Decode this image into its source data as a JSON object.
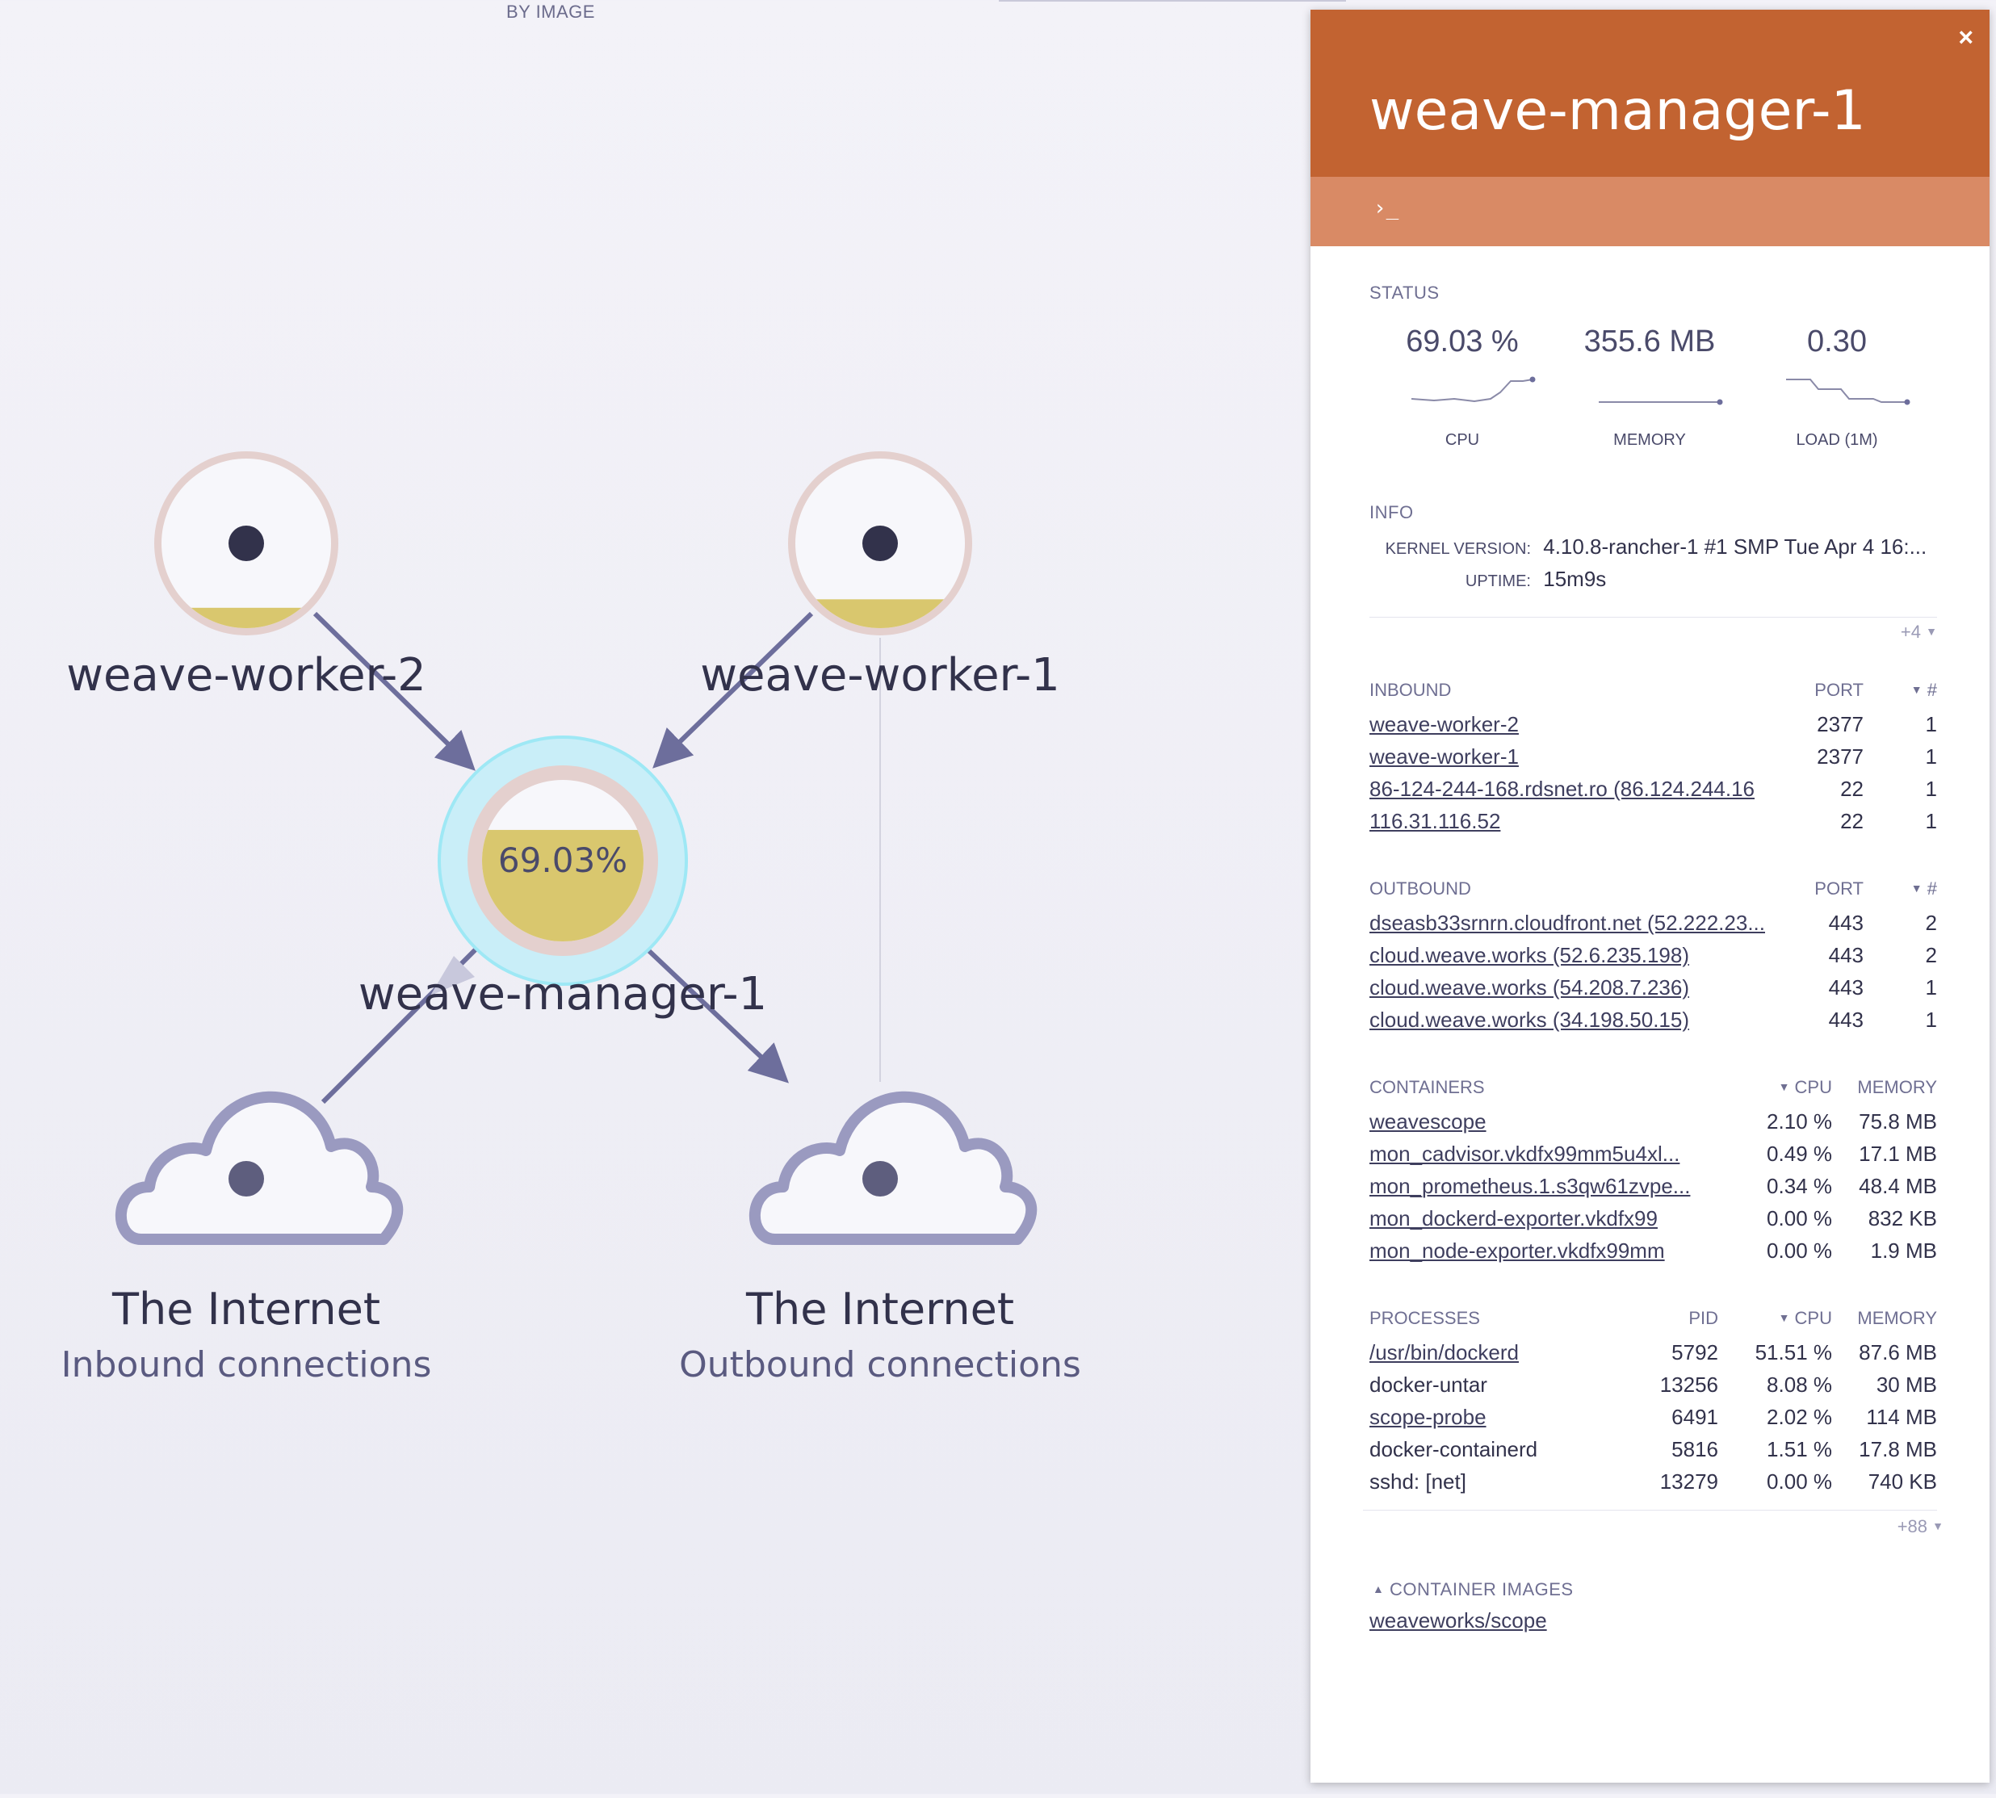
{
  "topology": {
    "view_label": "BY IMAGE",
    "nodes": {
      "worker2": {
        "label": "weave-worker-2",
        "metric_fraction": 0.12
      },
      "worker1": {
        "label": "weave-worker-1",
        "metric_fraction": 0.17
      },
      "manager": {
        "label": "weave-manager-1",
        "metric_text": "69.03%",
        "metric_fraction": 0.6903
      },
      "internet_in": {
        "label": "The Internet",
        "sublabel": "Inbound connections"
      },
      "internet_out": {
        "label": "The Internet",
        "sublabel": "Outbound connections"
      }
    },
    "colors": {
      "accent": "#c26331",
      "edge": "#6d6e9c",
      "metric_fill": "#d9c76e",
      "focus": "#9ee8f5"
    }
  },
  "details": {
    "title": "weave-manager-1",
    "close_icon": "×",
    "terminal_icon": "›_",
    "status": {
      "title": "STATUS",
      "metrics": [
        {
          "value": "69.03 %",
          "label": "CPU"
        },
        {
          "value": "355.6 MB",
          "label": "MEMORY"
        },
        {
          "value": "0.30",
          "label": "LOAD (1M)"
        }
      ]
    },
    "info": {
      "title": "INFO",
      "rows": [
        {
          "key": "KERNEL VERSION:",
          "value": "4.10.8-rancher-1 #1 SMP Tue Apr 4 16:..."
        },
        {
          "key": "UPTIME:",
          "value": "15m9s"
        }
      ],
      "more": "+4"
    },
    "inbound": {
      "title": "INBOUND",
      "col_port": "PORT",
      "col_count": "#",
      "rows": [
        {
          "name": "weave-worker-2",
          "port": "2377",
          "count": "1"
        },
        {
          "name": "weave-worker-1",
          "port": "2377",
          "count": "1"
        },
        {
          "name": "86-124-244-168.rdsnet.ro (86.124.244.16",
          "port": "22",
          "count": "1"
        },
        {
          "name": "116.31.116.52",
          "port": "22",
          "count": "1"
        }
      ]
    },
    "outbound": {
      "title": "OUTBOUND",
      "col_port": "PORT",
      "col_count": "#",
      "rows": [
        {
          "name": "dseasb33srnrn.cloudfront.net (52.222.23...",
          "port": "443",
          "count": "2"
        },
        {
          "name": "cloud.weave.works (52.6.235.198)",
          "port": "443",
          "count": "2"
        },
        {
          "name": "cloud.weave.works (54.208.7.236)",
          "port": "443",
          "count": "1"
        },
        {
          "name": "cloud.weave.works (34.198.50.15)",
          "port": "443",
          "count": "1"
        }
      ]
    },
    "containers": {
      "title": "CONTAINERS",
      "col_cpu": "CPU",
      "col_mem": "MEMORY",
      "rows": [
        {
          "name": "weavescope",
          "cpu": "2.10 %",
          "mem": "75.8 MB"
        },
        {
          "name": "mon_cadvisor.vkdfx99mm5u4xl...",
          "cpu": "0.49 %",
          "mem": "17.1 MB"
        },
        {
          "name": "mon_prometheus.1.s3qw61zvpe...",
          "cpu": "0.34 %",
          "mem": "48.4 MB"
        },
        {
          "name": "mon_dockerd-exporter.vkdfx99",
          "cpu": "0.00 %",
          "mem": "832 KB"
        },
        {
          "name": "mon_node-exporter.vkdfx99mm",
          "cpu": "0.00 %",
          "mem": "1.9 MB"
        }
      ]
    },
    "processes": {
      "title": "PROCESSES",
      "col_pid": "PID",
      "col_cpu": "CPU",
      "col_mem": "MEMORY",
      "rows": [
        {
          "name": "/usr/bin/dockerd",
          "pid": "5792",
          "cpu": "51.51 %",
          "mem": "87.6 MB",
          "link": true
        },
        {
          "name": "docker-untar",
          "pid": "13256",
          "cpu": "8.08 %",
          "mem": "30 MB",
          "link": false
        },
        {
          "name": "scope-probe",
          "pid": "6491",
          "cpu": "2.02 %",
          "mem": "114 MB",
          "link": true
        },
        {
          "name": "docker-containerd",
          "pid": "5816",
          "cpu": "1.51 %",
          "mem": "17.8 MB",
          "link": false
        },
        {
          "name": "sshd: [net]",
          "pid": "13279",
          "cpu": "0.00 %",
          "mem": "740 KB",
          "link": false
        }
      ],
      "more": "+88"
    },
    "images": {
      "title": "CONTAINER IMAGES",
      "items": [
        "weaveworks/scope"
      ]
    }
  }
}
